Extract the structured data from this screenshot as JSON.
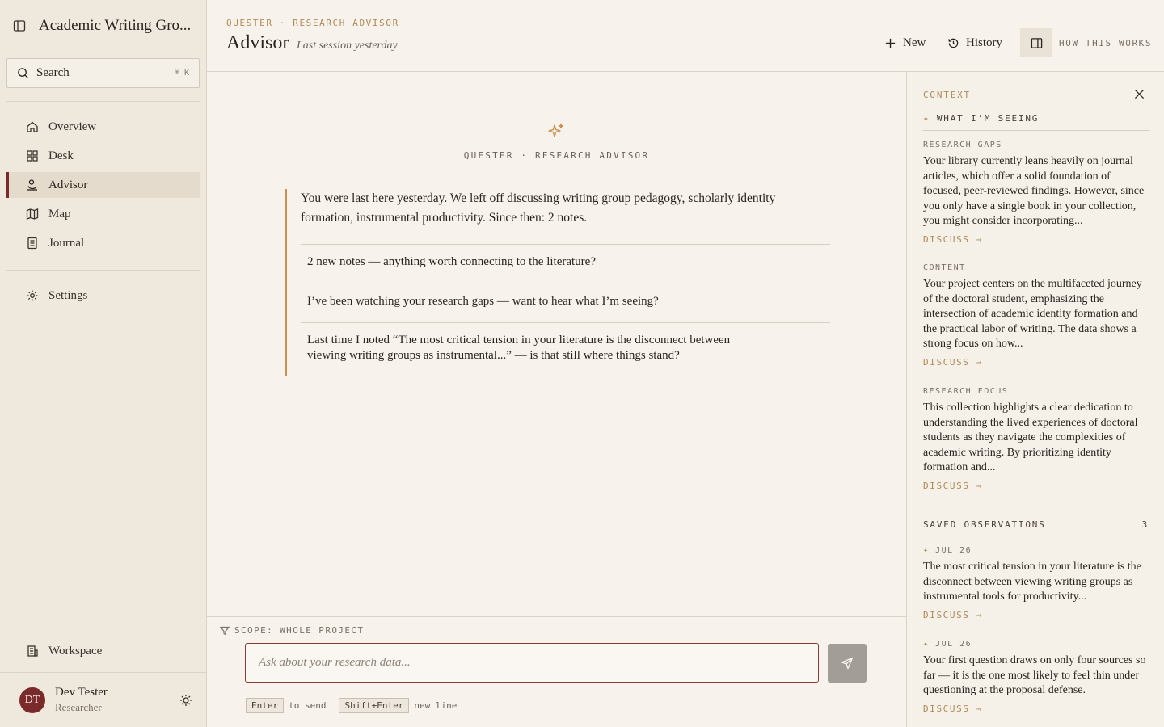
{
  "sidebar": {
    "title": "Academic Writing Gro...",
    "search_label": "Search",
    "search_shortcut": "⌘ K",
    "items": [
      {
        "label": "Overview"
      },
      {
        "label": "Desk"
      },
      {
        "label": "Advisor"
      },
      {
        "label": "Map"
      },
      {
        "label": "Journal"
      }
    ],
    "settings_label": "Settings",
    "workspace_label": "Workspace",
    "user": {
      "initials": "DT",
      "name": "Dev Tester",
      "role": "Researcher"
    }
  },
  "header": {
    "breadcrumb": "QUESTER · RESEARCH ADVISOR",
    "title": "Advisor",
    "subtitle": "Last session yesterday",
    "new_label": "New",
    "history_label": "History",
    "how_label": "HOW THIS WORKS"
  },
  "main": {
    "advisor_label": "QUESTER · RESEARCH ADVISOR",
    "message": "You were last here yesterday. We left off discussing writing group pedagogy, scholarly identity formation, instrumental productivity. Since then: 2 notes.",
    "suggestions": [
      "2 new notes — anything worth connecting to the literature?",
      "I’ve been watching your research gaps — want to hear what I’m seeing?",
      "Last time I noted “The most critical tension in your literature is the disconnect between viewing writing groups as instrumental...” — is that still where things stand?"
    ]
  },
  "composer": {
    "scope": "SCOPE: WHOLE PROJECT",
    "placeholder": "Ask about your research data...",
    "hint_enter_key": "Enter",
    "hint_enter_text": "to send",
    "hint_shift_key": "Shift+Enter",
    "hint_shift_text": "new line"
  },
  "context_panel": {
    "title": "CONTEXT",
    "subtitle": "WHAT I’M SEEING",
    "cards": [
      {
        "label": "RESEARCH GAPS",
        "body": "Your library currently leans heavily on journal articles, which offer a solid foundation of focused, peer-reviewed findings. However, since you only have a single book in your collection, you might consider incorporating...",
        "action": "DISCUSS →"
      },
      {
        "label": "CONTENT",
        "body": "Your project centers on the multifaceted journey of the doctoral student, emphasizing the intersection of academic identity formation and the practical labor of writing. The data shows a strong focus on how...",
        "action": "DISCUSS →"
      },
      {
        "label": "RESEARCH FOCUS",
        "body": "This collection highlights a clear dedication to understanding the lived experiences of doctoral students as they navigate the complexities of academic writing. By prioritizing identity formation and...",
        "action": "DISCUSS →"
      }
    ],
    "saved_title": "SAVED OBSERVATIONS",
    "saved_count": "3",
    "observations": [
      {
        "date": "JUL 26",
        "body": "The most critical tension in your literature is the disconnect between viewing writing groups as instrumental tools for productivity...",
        "action": "DISCUSS →"
      },
      {
        "date": "JUL 26",
        "body": "Your first question draws on only four sources so far — it is the one most likely to feel thin under questioning at the proposal defense.",
        "action": "DISCUSS →"
      }
    ]
  },
  "colors": {
    "accent": "#7a2a2a",
    "gold": "#b08a56",
    "background": "#f7f3ec"
  }
}
